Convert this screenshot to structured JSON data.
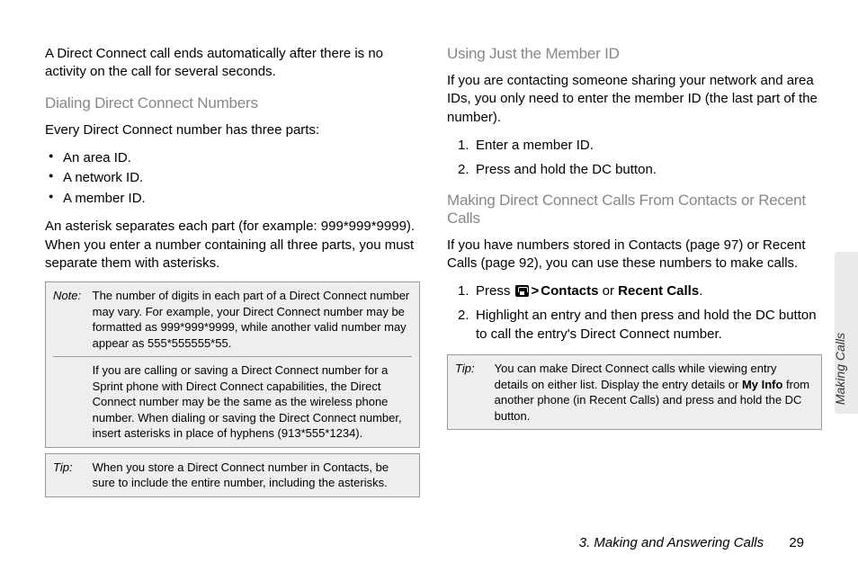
{
  "left": {
    "intro": "A Direct Connect call ends automatically after there is no activity on the call for several seconds.",
    "h_dialing": "Dialing Direct Connect Numbers",
    "parts_intro": "Every Direct Connect number has three parts:",
    "bullets": [
      "An area ID.",
      "A network ID.",
      "A member ID."
    ],
    "asterisk_para": "An asterisk separates each part (for example: 999*999*9999). When you enter a number containing all three parts, you must separate them with asterisks.",
    "note_label": "Note:",
    "note_p1": "The number of digits in each part of a Direct Connect number may vary. For example, your Direct Connect number may be formatted as 999*999*9999, while another valid number may appear as 555*555555*55.",
    "note_p2": "If you are calling or saving a Direct Connect number for a Sprint phone with Direct Connect capabilities, the Direct Connect number may be the same as the wireless phone number. When dialing or saving the Direct Connect number, insert asterisks in place of hyphens (913*555*1234).",
    "tip_label": "Tip:",
    "tip_text": "When you store a Direct Connect number in Contacts, be sure to include the entire number, including the asterisks."
  },
  "right": {
    "h_member": "Using Just the Member ID",
    "member_para": "If you are contacting someone sharing your network and area IDs, you only need to enter the member ID (the last part of the number).",
    "member_steps": [
      "Enter a member ID.",
      "Press and hold the DC button."
    ],
    "h_contacts": "Making Direct Connect Calls From Contacts or Recent Calls",
    "contacts_para": "If you have numbers stored in Contacts (page 97) or Recent Calls (page 92), you can use these numbers to make calls.",
    "step1_pre": "Press ",
    "step1_contacts": "Contacts",
    "step1_or": " or ",
    "step1_recent": "Recent Calls",
    "step1_end": ".",
    "step2": "Highlight an entry and then press and hold the DC button to call the entry's Direct Connect number.",
    "tip_label": "Tip:",
    "tip_pre": "You can make Direct Connect calls while viewing entry details on either list. Display the entry details or ",
    "tip_bold": "My Info",
    "tip_post": " from another phone (in Recent Calls) and press and hold the DC button."
  },
  "side_label": "Making Calls",
  "footer_chapter": "3. Making and Answering Calls",
  "footer_page": "29"
}
